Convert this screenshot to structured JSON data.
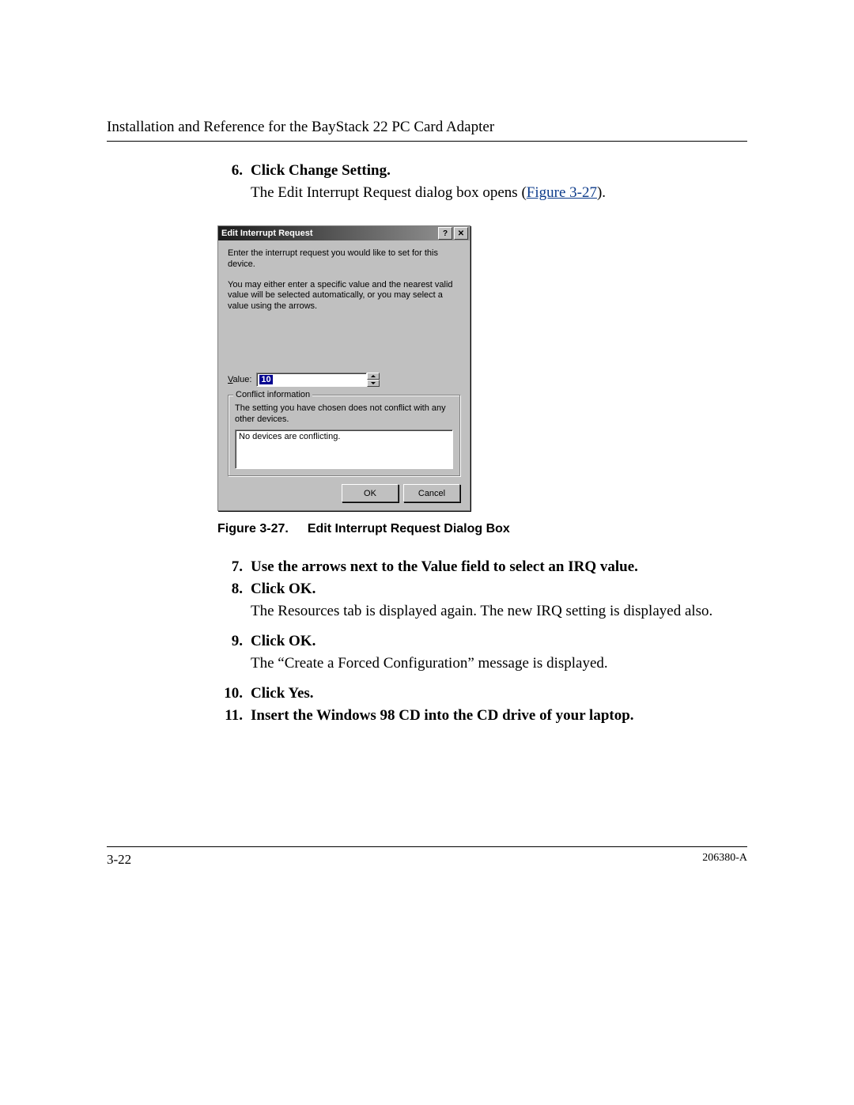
{
  "header": {
    "title": "Installation and Reference for the BayStack 22 PC Card Adapter"
  },
  "steps": {
    "s6": {
      "num": "6.",
      "label": "Click Change Setting."
    },
    "s6_para_a": "The Edit Interrupt Request dialog box opens (",
    "s6_link": "Figure 3-27",
    "s6_para_b": ").",
    "s7": {
      "num": "7.",
      "label": "Use the arrows next to the Value field to select an IRQ value."
    },
    "s8": {
      "num": "8.",
      "label": "Click OK."
    },
    "s8_para": "The Resources tab is displayed again. The new IRQ setting is displayed also.",
    "s9": {
      "num": "9.",
      "label": "Click OK."
    },
    "s9_para": "The “Create a Forced Configuration” message is displayed.",
    "s10": {
      "num": "10.",
      "label": "Click Yes."
    },
    "s11": {
      "num": "11.",
      "label": "Insert the Windows 98 CD into the CD drive of your laptop."
    }
  },
  "dialog": {
    "title": "Edit Interrupt Request",
    "help_glyph": "?",
    "close_glyph": "✕",
    "p1": "Enter the interrupt request you would like to set for this device.",
    "p2": "You may either enter a specific value and the nearest valid value will be selected automatically, or you may select a value using the arrows.",
    "value_prefix": "V",
    "value_suffix": "alue:",
    "value": "10",
    "group_title": "Conflict information",
    "group_msg": "The setting you have chosen does not conflict with any other devices.",
    "list_text": "No devices are conflicting.",
    "ok": "OK",
    "cancel": "Cancel"
  },
  "figure": {
    "label": "Figure 3-27.",
    "caption": "Edit Interrupt Request Dialog Box"
  },
  "footer": {
    "page": "3-22",
    "doc": "206380-A"
  }
}
